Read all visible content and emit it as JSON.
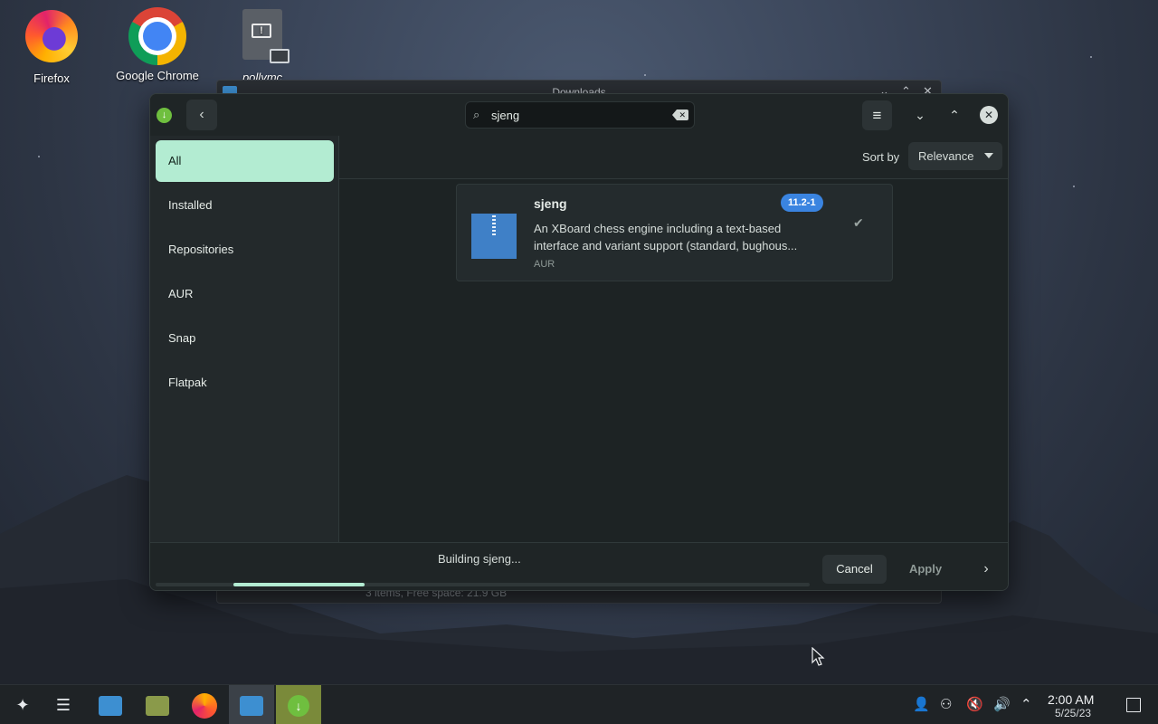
{
  "desktop": {
    "icons": [
      {
        "label": "Firefox",
        "icon": "firefox-icon"
      },
      {
        "label": "Google Chrome",
        "icon": "chrome-icon"
      },
      {
        "label": "pollymc",
        "icon": "executable-file-icon"
      }
    ]
  },
  "background_window": {
    "title": "Downloads",
    "status": "3 items, Free space: 21.9 GB"
  },
  "app": {
    "search": {
      "value": "sjeng",
      "placeholder": "Search"
    },
    "sidebar": {
      "items": [
        {
          "label": "All",
          "active": true
        },
        {
          "label": "Installed",
          "active": false
        },
        {
          "label": "Repositories",
          "active": false
        },
        {
          "label": "AUR",
          "active": false
        },
        {
          "label": "Snap",
          "active": false
        },
        {
          "label": "Flatpak",
          "active": false
        }
      ]
    },
    "sort": {
      "label": "Sort by",
      "selected": "Relevance"
    },
    "results": [
      {
        "name": "sjeng",
        "version": "11.2-1",
        "description": "An XBoard chess engine including a text-based interface and variant support (standard, bughous...",
        "repo": "AUR",
        "selected": true
      }
    ],
    "footer": {
      "status": "Building sjeng...",
      "progress": 0.2,
      "cancel_label": "Cancel",
      "apply_label": "Apply"
    }
  },
  "taskbar": {
    "clock_time": "2:00 AM",
    "clock_date": "5/25/23"
  },
  "colors": {
    "accent": "#b3ecd2",
    "version_badge": "#3a84e0",
    "package_icon": "#3f80c7"
  }
}
